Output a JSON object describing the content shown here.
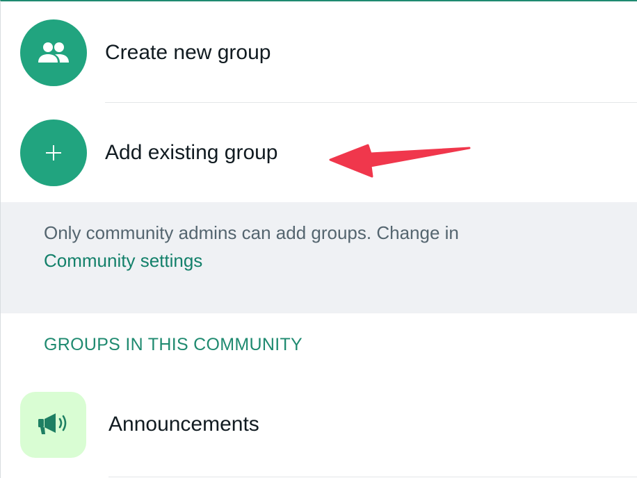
{
  "menu": {
    "create_group_label": "Create new group",
    "add_existing_label": "Add existing group"
  },
  "notice": {
    "text": "Only community admins can add groups. Change in",
    "link": "Community settings"
  },
  "groups_section": {
    "header": "GROUPS IN THIS COMMUNITY",
    "items": [
      {
        "label": "Announcements",
        "icon": "megaphone-icon"
      }
    ]
  },
  "icons": {
    "create_group": "people-icon",
    "add_existing": "plus-icon"
  },
  "colors": {
    "accent": "#21a47f",
    "link": "#13806a",
    "annotation_arrow": "#f0374c",
    "announcement_bg": "#d9fdd3"
  }
}
